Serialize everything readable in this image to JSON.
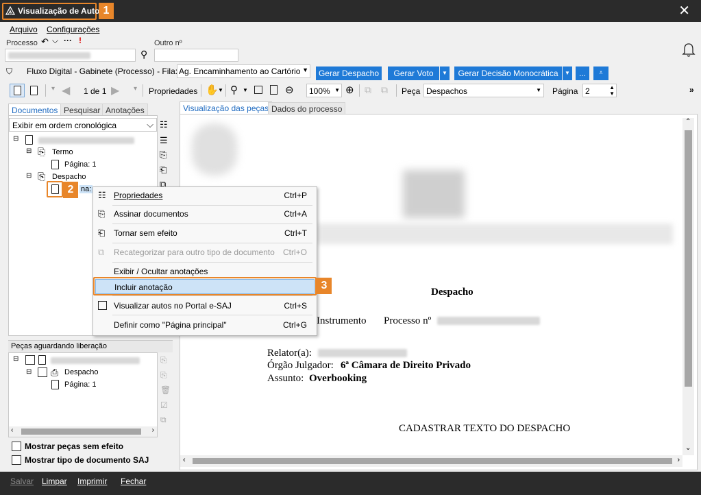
{
  "window": {
    "title": "Visualização de Autos",
    "badge1": "1",
    "badge2": "2",
    "badge3": "3"
  },
  "menubar": {
    "arquivo": "Arquivo",
    "configuracoes": "Configurações"
  },
  "header": {
    "processo_label": "Processo",
    "outro_label": "Outro nº",
    "fluxo_text": "Fluxo Digital - Gabinete (Processo) - Fila:",
    "fila_value": "Ag. Encaminhamento ao Cartório",
    "btn_gerar_despacho": "Gerar Despacho",
    "btn_gerar_voto": "Gerar Voto",
    "btn_gerar_decisao": "Gerar Decisão Monocrática",
    "btn_more": "..."
  },
  "toolbar": {
    "page_of": "1 de 1",
    "propriedades": "Propriedades",
    "zoom": "100%",
    "peca_label": "Peça",
    "peca_value": "Despachos",
    "pagina_label": "Página",
    "pagina_value": "2"
  },
  "left": {
    "tabs": [
      "Documentos",
      "Pesquisar",
      "Anotações"
    ],
    "order_select": "Exibir em ordem cronológica",
    "tree": {
      "termo": "Termo",
      "pagina1": "Página: 1",
      "despacho": "Despacho",
      "pagina_partial": "na:"
    },
    "pending_title": "Peças aguardando liberação",
    "pending_tree": {
      "despacho": "Despacho",
      "pagina1": "Página: 1"
    },
    "chk_sem_efeito": "Mostrar peças sem efeito",
    "chk_tipo_doc": "Mostrar tipo de documento SAJ"
  },
  "right": {
    "tabs": [
      "Visualização das peças",
      "Dados do processo"
    ],
    "doc": {
      "heading": "Despacho",
      "instrumento": "Instrumento",
      "processo": "Processo nº",
      "relator": "Relator(a):",
      "orgao_label": "Órgão Julgador:",
      "orgao_value": "6ª Câmara de Direito Privado",
      "assunto_label": "Assunto:",
      "assunto_value": "Overbooking",
      "body": "CADASTRAR TEXTO DO DESPACHO"
    }
  },
  "context_menu": [
    {
      "label": "Propriedades",
      "shortcut": "Ctrl+P",
      "disabled": false
    },
    {
      "label": "Assinar documentos",
      "shortcut": "Ctrl+A",
      "disabled": false
    },
    {
      "label": "Tornar sem efeito",
      "shortcut": "Ctrl+T",
      "disabled": false
    },
    {
      "label": "Recategorizar para outro tipo de documento",
      "shortcut": "Ctrl+O",
      "disabled": true
    },
    {
      "label": "Exibir / Ocultar anotações",
      "shortcut": "",
      "disabled": false
    },
    {
      "label": "Incluir anotação",
      "shortcut": "",
      "disabled": false
    },
    {
      "label": "Visualizar autos no Portal e-SAJ",
      "shortcut": "Ctrl+S",
      "disabled": false
    },
    {
      "label": "Definir como \"Página principal\"",
      "shortcut": "Ctrl+G",
      "disabled": false
    }
  ],
  "status": {
    "salvar": "Salvar",
    "limpar": "Limpar",
    "imprimir": "Imprimir",
    "fechar": "Fechar"
  },
  "colors": {
    "accent": "#e8862a",
    "button_blue": "#1f7ad7",
    "titlebar": "#2b2b2b"
  }
}
